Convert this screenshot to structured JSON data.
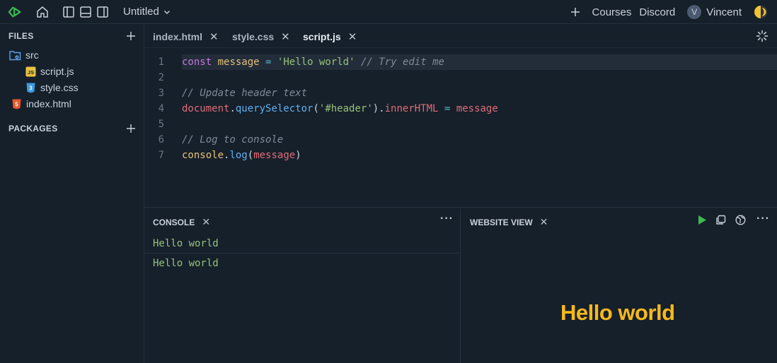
{
  "topbar": {
    "project_title": "Untitled",
    "links": [
      "Courses",
      "Discord"
    ],
    "user_initial": "V",
    "user_name": "Vincent"
  },
  "sidebar": {
    "files_title": "FILES",
    "packages_title": "PACKAGES",
    "tree": [
      {
        "name": "src",
        "type": "folder"
      },
      {
        "name": "script.js",
        "type": "js"
      },
      {
        "name": "style.css",
        "type": "css"
      },
      {
        "name": "index.html",
        "type": "html"
      }
    ]
  },
  "tabs": [
    {
      "label": "index.html",
      "active": false
    },
    {
      "label": "style.css",
      "active": false
    },
    {
      "label": "script.js",
      "active": true
    }
  ],
  "editor": {
    "line_numbers": [
      "1",
      "2",
      "3",
      "4",
      "5",
      "6",
      "7"
    ],
    "lines": [
      [
        [
          "kw",
          "const"
        ],
        [
          "plain",
          " "
        ],
        [
          "var",
          "message"
        ],
        [
          "plain",
          " "
        ],
        [
          "op",
          "="
        ],
        [
          "plain",
          " "
        ],
        [
          "str",
          "'Hello world'"
        ],
        [
          "plain",
          " "
        ],
        [
          "cmt",
          "// Try edit me"
        ]
      ],
      [],
      [
        [
          "cmt",
          "// Update header text"
        ]
      ],
      [
        [
          "obj",
          "document"
        ],
        [
          "plain",
          "."
        ],
        [
          "fn",
          "querySelector"
        ],
        [
          "plain",
          "("
        ],
        [
          "str",
          "'#header'"
        ],
        [
          "plain",
          ")."
        ],
        [
          "obj",
          "innerHTML"
        ],
        [
          "plain",
          " "
        ],
        [
          "op",
          "="
        ],
        [
          "plain",
          " "
        ],
        [
          "obj",
          "message"
        ]
      ],
      [],
      [
        [
          "cmt",
          "// Log to console"
        ]
      ],
      [
        [
          "var",
          "console"
        ],
        [
          "plain",
          "."
        ],
        [
          "fn",
          "log"
        ],
        [
          "plain",
          "("
        ],
        [
          "obj",
          "message"
        ],
        [
          "plain",
          ")"
        ]
      ]
    ]
  },
  "console": {
    "title": "CONSOLE",
    "logs": [
      "Hello world",
      "Hello world"
    ]
  },
  "website": {
    "title": "WEBSITE VIEW",
    "heading": "Hello world"
  },
  "colors": {
    "accent_green": "#3fb950",
    "heading_yellow": "#f6b91c",
    "background": "#16202b"
  }
}
